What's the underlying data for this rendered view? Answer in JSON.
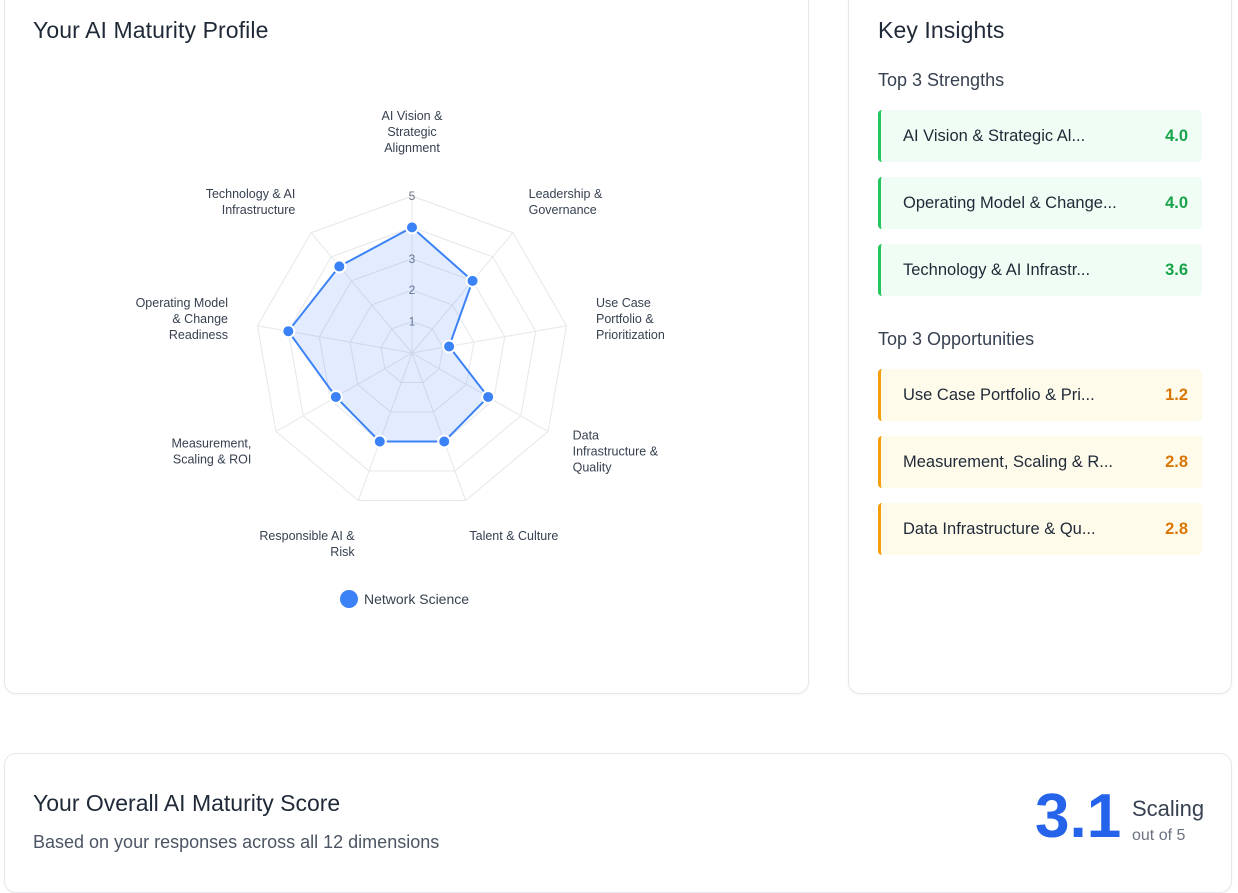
{
  "profile": {
    "title": "Your AI Maturity Profile"
  },
  "chart_data": {
    "type": "radar",
    "axes": [
      "AI Vision & Strategic Alignment",
      "Leadership & Governance",
      "Use Case Portfolio & Prioritization",
      "Data Infrastructure & Quality",
      "Talent & Culture",
      "Responsible AI & Risk",
      "Measurement, Scaling & ROI",
      "Operating Model & Change Readiness",
      "Technology & AI Infrastructure"
    ],
    "axis_label_lines": [
      [
        "AI Vision &",
        "Strategic",
        "Alignment"
      ],
      [
        "Leadership &",
        "Governance"
      ],
      [
        "Use Case",
        "Portfolio &",
        "Prioritization"
      ],
      [
        "Data",
        "Infrastructure &",
        "Quality"
      ],
      [
        "Talent & Culture"
      ],
      [
        "Responsible AI &",
        "Risk"
      ],
      [
        "Measurement,",
        "Scaling & ROI"
      ],
      [
        "Operating Model",
        "& Change",
        "Readiness"
      ],
      [
        "Technology & AI",
        "Infrastructure"
      ]
    ],
    "rlim": [
      0,
      5
    ],
    "tick_labels": [
      "1",
      "2",
      "3",
      "5"
    ],
    "series": [
      {
        "name": "Network Science",
        "values": [
          4.0,
          3.0,
          1.2,
          2.8,
          3.0,
          3.0,
          2.8,
          4.0,
          3.6
        ],
        "color": "#3b82f6"
      }
    ],
    "legend": "bottom",
    "grid": true
  },
  "insights": {
    "title": "Key Insights",
    "strengths_heading": "Top 3 Strengths",
    "strengths": [
      {
        "name": "AI Vision & Strategic Al...",
        "score": "4.0"
      },
      {
        "name": "Operating Model & Change...",
        "score": "4.0"
      },
      {
        "name": "Technology & AI Infrastr...",
        "score": "3.6"
      }
    ],
    "opportunities_heading": "Top 3 Opportunities",
    "opportunities": [
      {
        "name": "Use Case Portfolio & Pri...",
        "score": "1.2"
      },
      {
        "name": "Measurement, Scaling & R...",
        "score": "2.8"
      },
      {
        "name": "Data Infrastructure & Qu...",
        "score": "2.8"
      }
    ],
    "strength_color": "#16a34a",
    "opportunity_color": "#d97706"
  },
  "overall": {
    "title": "Your Overall AI Maturity Score",
    "subtitle": "Based on your responses across all 12 dimensions",
    "score": "3.1",
    "stage": "Scaling",
    "out_of": "out of 5",
    "score_color": "#2563eb"
  }
}
